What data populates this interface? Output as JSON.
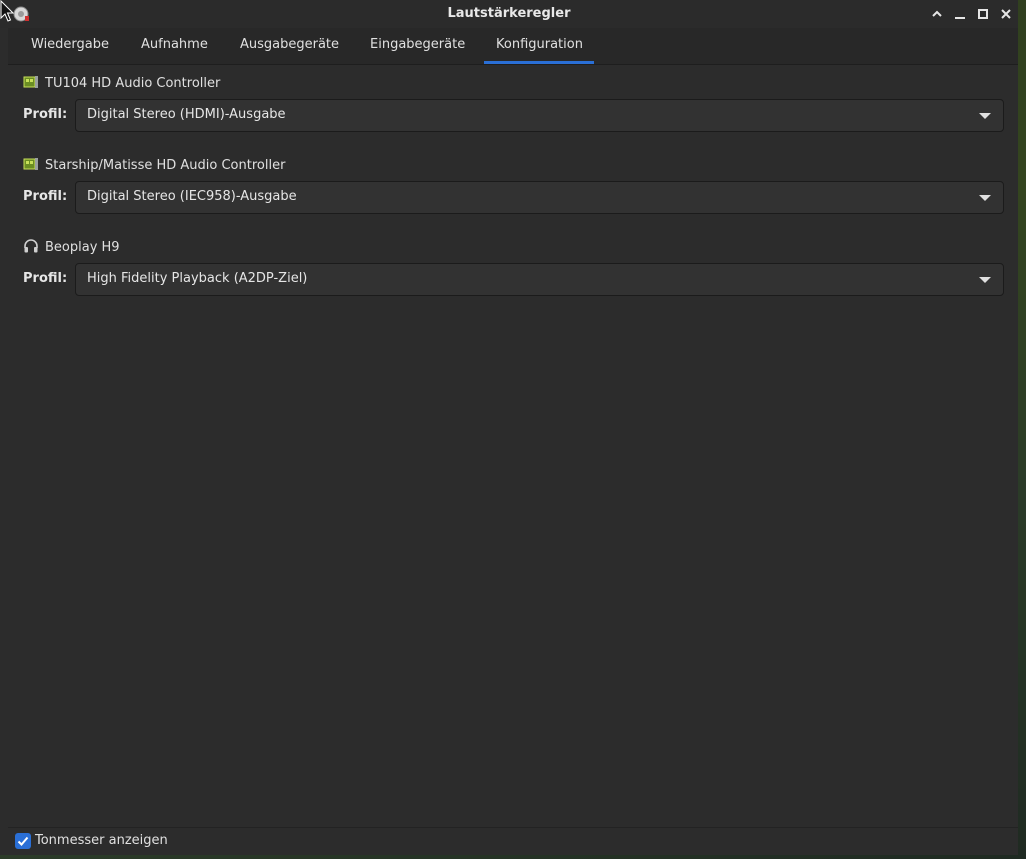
{
  "window": {
    "title": "Lautstärkeregler"
  },
  "tabs": [
    {
      "label": "Wiedergabe"
    },
    {
      "label": "Aufnahme"
    },
    {
      "label": "Ausgabegeräte"
    },
    {
      "label": "Eingabegeräte"
    },
    {
      "label": "Konfiguration",
      "active": true
    }
  ],
  "cards": [
    {
      "name": "TU104 HD Audio Controller",
      "icon": "sound-card-icon",
      "profile_label": "Profil:",
      "profile_value": "Digital Stereo (HDMI)-Ausgabe"
    },
    {
      "name": "Starship/Matisse HD Audio Controller",
      "icon": "sound-card-icon",
      "profile_label": "Profil:",
      "profile_value": "Digital Stereo (IEC958)-Ausgabe"
    },
    {
      "name": "Beoplay H9",
      "icon": "headphones-icon",
      "profile_label": "Profil:",
      "profile_value": "High Fidelity Playback (A2DP-Ziel)"
    }
  ],
  "footer": {
    "show_meters_label": "Tonmesser anzeigen",
    "show_meters_checked": true
  },
  "colors": {
    "accent": "#2a6fd6",
    "window_bg": "#2c2c2c",
    "text": "#e0e0e0",
    "card_icon": "#9acd32"
  }
}
